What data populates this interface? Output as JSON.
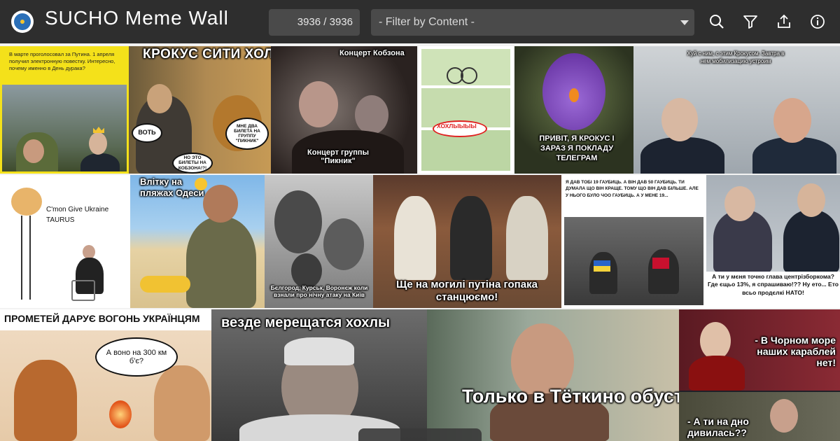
{
  "header": {
    "title": "SUCHO Meme Wall",
    "counter": "3936 / 3936",
    "filter_placeholder": "- Filter by Content -",
    "icons": [
      "search-icon",
      "filter-icon",
      "share-icon",
      "info-icon"
    ]
  },
  "colors": {
    "header_bg": "#2e2e2e",
    "input_bg": "#4a4a4a",
    "accent_yellow": "#f4e11a"
  },
  "memes": {
    "m1": {
      "text": "В марте проголосовал за Путина. 1 апреля получил электронную повестку. Интересно, почему именно в День дурака?"
    },
    "m2": {
      "title": "КРОКУС СИТИ ХОЛЛ",
      "b1": "ВОТЬ",
      "b2": "МНЕ ДВА БИЛЕТА НА ГРУППУ \"ПИКНИК\"",
      "b3": "НО ЭТО БИЛЕТЫ НА КОБЗОНА!?!"
    },
    "m3": {
      "top": "Концерт Кобзона",
      "bottom": "Концерт группы \"Пикник\""
    },
    "m4": {
      "text": "ХОХЛЫЫЫЫ"
    },
    "m5": {
      "text": "ПРИВІТ, Я КРОКУС І ЗАРАЗ Я ПОКЛАДУ ТЕЛЕГРАМ"
    },
    "m6": {
      "text": "Хуй с ним, с этим Крокусом. Завтра в нем мобилизацию устроим"
    },
    "m7": {
      "text": "C'mon Give Ukraine TAURUS"
    },
    "m8": {
      "text": "Влітку на пляжах Одеси"
    },
    "m9": {
      "text": "Бєлгород, Курськ, Воронєж коли взнали про нічну атаку на Київ"
    },
    "m10": {
      "text": "Ще на могилі путіна гопака станцюємо!"
    },
    "m11": {
      "text": "Я ДАВ ТОБІ 19 ГАУБИЦЬ. А ВІН ДАВ 50 ГАУБИЦЬ. ТИ ДУМАЛА ЩО ВІН КРАЩЕ. ТОМУ ЩО ВІН ДАВ БІЛЬШЕ. АЛЕ У НЬОГО БУЛО ЧОО ГАУБИЦЬ. А У МЕНЕ 19..."
    },
    "m12": {
      "text": "А ти у мєня точно глава центрізборкома? Где єщьо 13%, я спрашиваю!?? Ну ето... Ето всьо продєлкі НАТО!"
    },
    "m13": {
      "title": "ПРОМЕТЕЙ ДАРУЄ ВОГОНЬ УКРАЇНЦЯМ",
      "bubble": "А воно на 300 км б'є?"
    },
    "m14": {
      "text": "везде мерещатся хохлы"
    },
    "m15": {
      "text": "Только в Тёткино обустроилась,"
    },
    "m16": {
      "top": "- В Чорном море наших караблей нет!",
      "bottom": "- А ти на дно дивилась??"
    }
  }
}
